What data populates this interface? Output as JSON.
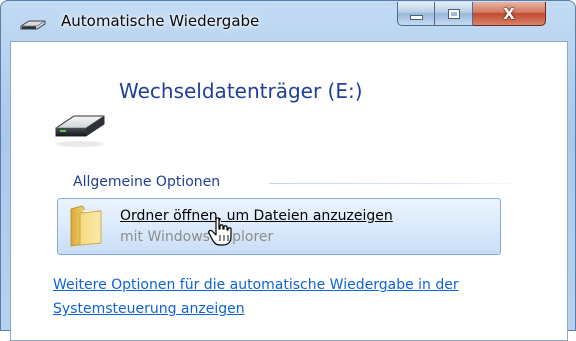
{
  "window": {
    "title": "Automatische Wiedergabe",
    "caption_buttons": {
      "minimize_icon": "minimize-icon",
      "maximize_icon": "maximize-icon",
      "close_label": "X"
    }
  },
  "device": {
    "title": "Wechseldatenträger (E:)",
    "icon": "removable-drive-icon"
  },
  "section": {
    "heading": "Allgemeine Optionen"
  },
  "option": {
    "title": "Ordner öffnen, um Dateien anzuzeigen",
    "subtitle": "mit Windows-Explorer",
    "icon": "folder-icon"
  },
  "more_options_link": "Weitere Optionen für die automatische Wiedergabe in der Systemsteuerung anzeigen",
  "colors": {
    "heading_blue": "#1f3f9a",
    "link_blue": "#0e63d8",
    "hover_fill": "#dcebfc",
    "close_red": "#c14a2f"
  }
}
